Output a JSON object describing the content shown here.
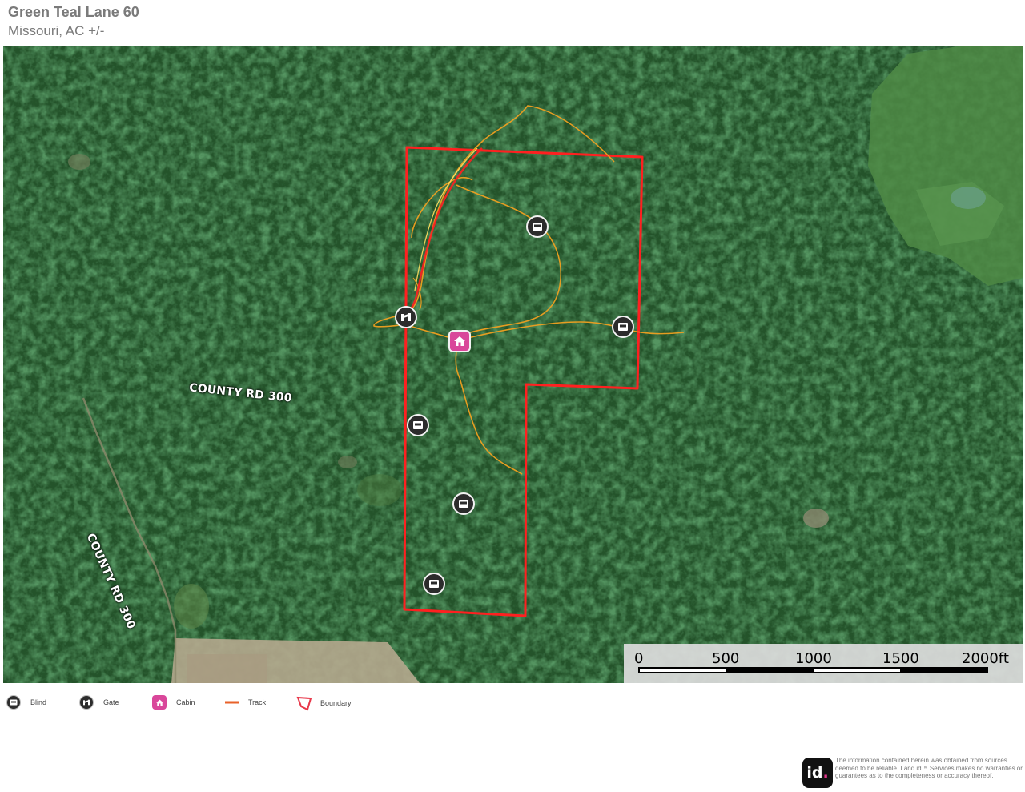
{
  "header": {
    "title": "Green Teal Lane 60",
    "subtitle": "Missouri,  AC +/-"
  },
  "map": {
    "road_labels": [
      "COUNTY RD 300",
      "COUNTY RD 300"
    ],
    "colors": {
      "boundary": "#ff2020",
      "track": "#f0a020",
      "cabin": "#d9479a",
      "marker": "#2c2c2c"
    },
    "markers": [
      {
        "type": "gate",
        "icon": "gate-icon"
      },
      {
        "type": "cabin",
        "icon": "cabin-icon"
      },
      {
        "type": "blind",
        "icon": "blind-icon"
      },
      {
        "type": "blind",
        "icon": "blind-icon"
      },
      {
        "type": "blind",
        "icon": "blind-icon"
      },
      {
        "type": "blind",
        "icon": "blind-icon"
      },
      {
        "type": "blind",
        "icon": "blind-icon"
      }
    ],
    "scale": {
      "labels": [
        "0",
        "500",
        "1000",
        "1500",
        "2000ft"
      ]
    }
  },
  "legend": {
    "items": [
      {
        "label": "Blind",
        "icon": "blind-icon"
      },
      {
        "label": "Gate",
        "icon": "gate-icon"
      },
      {
        "label": "Cabin",
        "icon": "cabin-icon"
      },
      {
        "label": "Track",
        "icon": "track-line-icon"
      },
      {
        "label": "Boundary",
        "icon": "boundary-polygon-icon"
      }
    ]
  },
  "footer": {
    "logo_text": "id",
    "logo_dot": ".",
    "disclaimer": "The information contained herein was obtained from sources deemed to be reliable. Land id™ Services makes no warranties or guarantees as to the completeness or accuracy thereof."
  }
}
